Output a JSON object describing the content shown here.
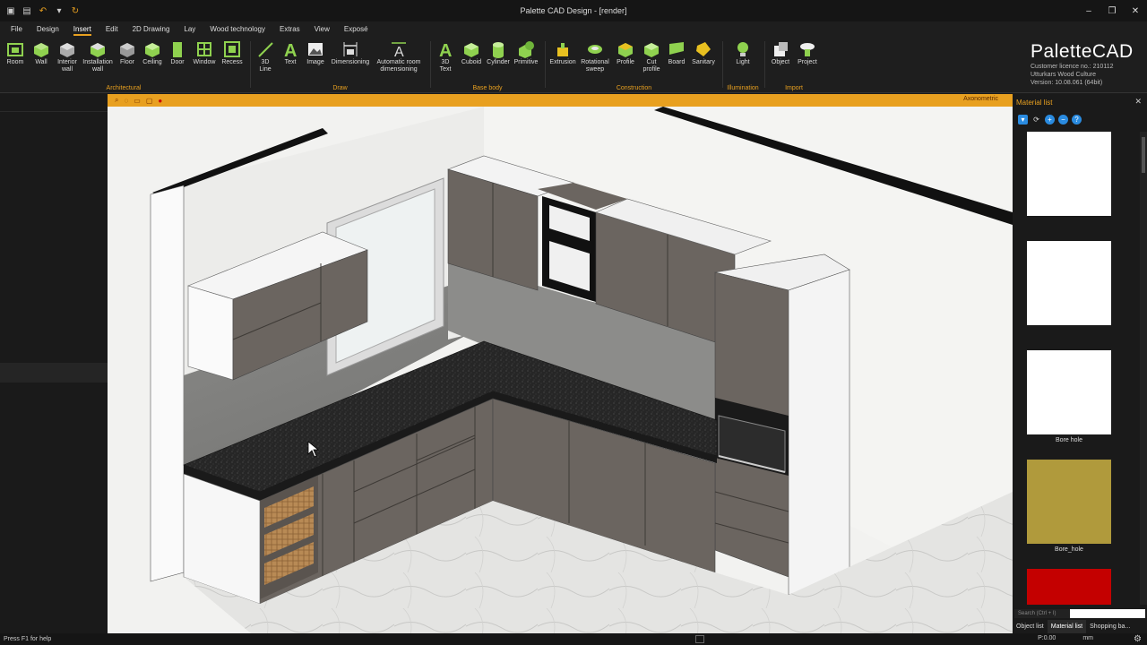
{
  "window": {
    "title": "Palette CAD Design - [render]",
    "controls": [
      "–",
      "❐",
      "✕"
    ]
  },
  "quick_access": [
    "save-icon",
    "print-icon",
    "undo-icon",
    "redo-icon",
    "dropdown-icon"
  ],
  "menu": [
    {
      "label": "File",
      "active": false
    },
    {
      "label": "Design",
      "active": false
    },
    {
      "label": "Insert",
      "active": true
    },
    {
      "label": "Edit",
      "active": false
    },
    {
      "label": "2D Drawing",
      "active": false
    },
    {
      "label": "Lay",
      "active": false
    },
    {
      "label": "Wood technology",
      "active": false
    },
    {
      "label": "Extras",
      "active": false
    },
    {
      "label": "View",
      "active": false
    },
    {
      "label": "Exposé",
      "active": false
    }
  ],
  "ribbon": {
    "architectural": {
      "name": "Architectural",
      "tools": [
        {
          "label": "Room",
          "icon": "room-icon"
        },
        {
          "label": "Wall",
          "icon": "wall-icon"
        },
        {
          "label": "Interior wall",
          "icon": "interior-wall-icon"
        },
        {
          "label": "Installation wall",
          "icon": "installation-wall-icon"
        },
        {
          "label": "Floor",
          "icon": "floor-icon"
        },
        {
          "label": "Ceiling",
          "icon": "ceiling-icon"
        },
        {
          "label": "Door",
          "icon": "door-icon"
        },
        {
          "label": "Window",
          "icon": "window-icon"
        },
        {
          "label": "Recess",
          "icon": "recess-icon"
        }
      ]
    },
    "draw": {
      "name": "Draw",
      "tools": [
        {
          "label": "3D Line",
          "icon": "line-icon"
        },
        {
          "label": "Text",
          "icon": "text-icon"
        },
        {
          "label": "Image",
          "icon": "image-icon"
        },
        {
          "label": "Dimensioning",
          "icon": "dimension-icon"
        },
        {
          "label": "Automatic room dimensioning",
          "icon": "auto-dimension-icon"
        }
      ]
    },
    "base_body": {
      "name": "Base body",
      "tools": [
        {
          "label": "3D Text",
          "icon": "3d-text-icon"
        },
        {
          "label": "Cuboid",
          "icon": "cuboid-icon"
        },
        {
          "label": "Cylinder",
          "icon": "cylinder-icon"
        },
        {
          "label": "Primitive",
          "icon": "primitive-icon"
        }
      ]
    },
    "construction": {
      "name": "Construction",
      "tools": [
        {
          "label": "Extrusion",
          "icon": "extrusion-icon"
        },
        {
          "label": "Rotational sweep",
          "icon": "rotational-sweep-icon"
        },
        {
          "label": "Profile",
          "icon": "profile-icon"
        },
        {
          "label": "Cut profile",
          "icon": "cut-profile-icon"
        },
        {
          "label": "Board",
          "icon": "board-icon"
        },
        {
          "label": "Sanitary",
          "icon": "sanitary-icon"
        }
      ]
    },
    "illumination": {
      "name": "Illumination",
      "tools": [
        {
          "label": "Light",
          "icon": "light-icon"
        }
      ]
    },
    "import": {
      "name": "Import",
      "tools": [
        {
          "label": "Object",
          "icon": "object-icon"
        },
        {
          "label": "Project",
          "icon": "project-icon"
        }
      ]
    }
  },
  "brand": {
    "logo": "PaletteCAD",
    "licence": "Customer licence no.: 210112",
    "customer": "Utturkars Wood Culture",
    "version": "Version: 10.08.061 (64bit)"
  },
  "viewport": {
    "view_label": "Axonometric",
    "tools": [
      "zoom-icon",
      "orbit-icon",
      "pan-icon",
      "fit-icon",
      "render-icon"
    ]
  },
  "material_list": {
    "title": "Material list",
    "tools": [
      "select-icon",
      "refresh-icon",
      "add-icon",
      "remove-icon",
      "help-icon"
    ],
    "swatches": [
      {
        "label": "",
        "color": "#ffffff"
      },
      {
        "label": "",
        "color": "#ffffff"
      },
      {
        "label": "Bore hole",
        "color": "#ffffff"
      },
      {
        "label": "Bore_hole",
        "color": "#b09a3c"
      },
      {
        "label": "",
        "color": "#c40000"
      }
    ],
    "search_placeholder": "Search (Ctrl + I)",
    "tabs": [
      {
        "label": "Object list",
        "active": false
      },
      {
        "label": "Material list",
        "active": true
      },
      {
        "label": "Shopping ba...",
        "active": false
      }
    ]
  },
  "status": {
    "help": "Press F1 for help",
    "coord": "P:0.00",
    "unit": "mm"
  },
  "colors": {
    "accent": "#e8a020",
    "cabinet": "#6b6560",
    "counter": "#2a2a2a"
  }
}
